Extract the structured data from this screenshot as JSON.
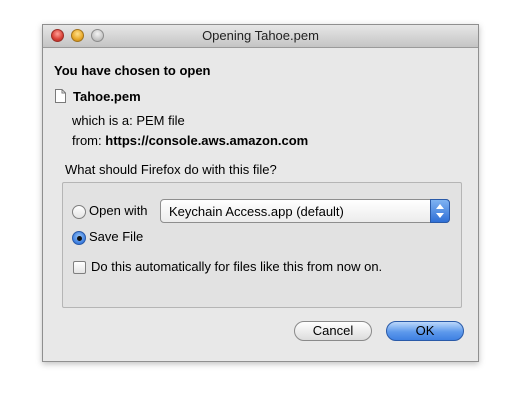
{
  "window": {
    "title": "Opening Tahoe.pem"
  },
  "dialog": {
    "heading": "You have chosen to open",
    "file_name": "Tahoe.pem",
    "type_label": "which is a:",
    "type_value": "PEM file",
    "from_label": "from:",
    "from_value": "https://console.aws.amazon.com",
    "question": "What should Firefox do with this file?"
  },
  "options": {
    "open_with_label": "Open with",
    "open_with_selected": false,
    "app_select_value": "Keychain Access.app (default)",
    "save_file_label": "Save File",
    "save_file_selected": true,
    "auto_label": "Do this automatically for files like this from now on.",
    "auto_checked": false
  },
  "buttons": {
    "cancel_label": "Cancel",
    "ok_label": "OK"
  },
  "colors": {
    "accent": "#3f80e2",
    "dialog_bg": "#e8e8e8",
    "close_button": "#d94036",
    "minimize_button": "#e8a92a"
  },
  "icons": {
    "file": "document-icon",
    "select": "up-down-arrows-icon"
  }
}
